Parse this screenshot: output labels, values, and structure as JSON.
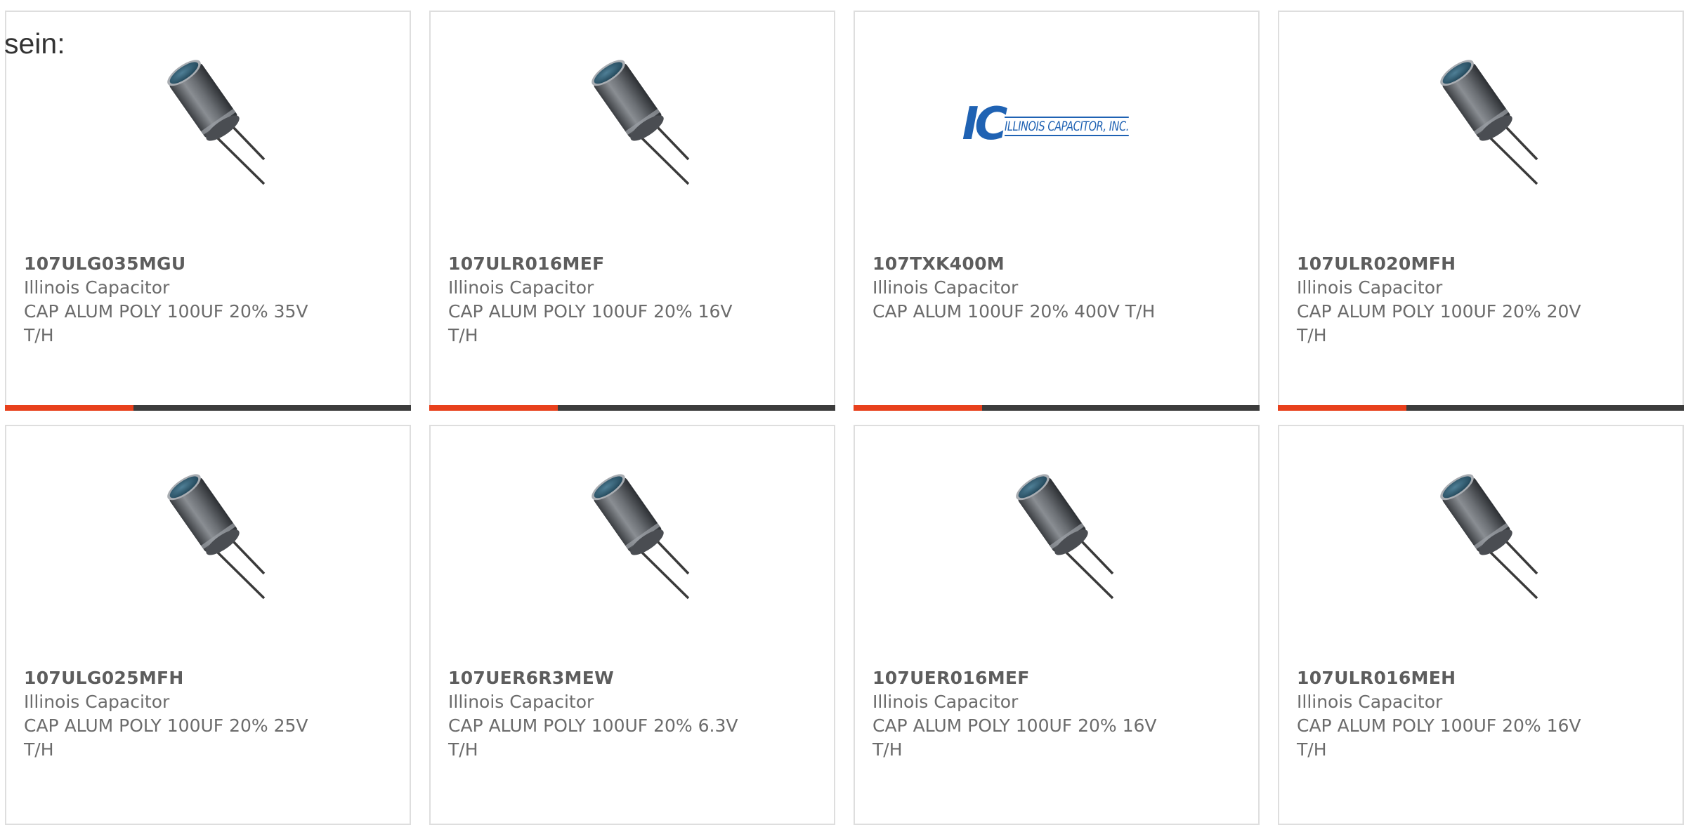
{
  "intro": "sein:",
  "accent_color": "#e8401c",
  "bar_color": "#3c3c3c",
  "logo": {
    "letters": "IC",
    "text": "ILLINOIS CAPACITOR, INC."
  },
  "products": [
    {
      "part_number": "107ULG035MGU",
      "manufacturer": "Illinois Capacitor",
      "description": "CAP ALUM POLY 100UF 20% 35V T/H",
      "image": "capacitor-image"
    },
    {
      "part_number": "107ULR016MEF",
      "manufacturer": "Illinois Capacitor",
      "description": "CAP ALUM POLY 100UF 20% 16V T/H",
      "image": "capacitor-image"
    },
    {
      "part_number": "107TXK400M",
      "manufacturer": "Illinois Capacitor",
      "description": "CAP ALUM 100UF 20% 400V T/H",
      "image": "manufacturer-logo"
    },
    {
      "part_number": "107ULR020MFH",
      "manufacturer": "Illinois Capacitor",
      "description": "CAP ALUM POLY 100UF 20% 20V T/H",
      "image": "capacitor-image"
    },
    {
      "part_number": "107ULG025MFH",
      "manufacturer": "Illinois Capacitor",
      "description": "CAP ALUM POLY 100UF 20% 25V T/H",
      "image": "capacitor-image"
    },
    {
      "part_number": "107UER6R3MEW",
      "manufacturer": "Illinois Capacitor",
      "description": "CAP ALUM POLY 100UF 20% 6.3V T/H",
      "image": "capacitor-image"
    },
    {
      "part_number": "107UER016MEF",
      "manufacturer": "Illinois Capacitor",
      "description": "CAP ALUM POLY 100UF 20% 16V T/H",
      "image": "capacitor-image"
    },
    {
      "part_number": "107ULR016MEH",
      "manufacturer": "Illinois Capacitor",
      "description": "CAP ALUM POLY 100UF 20% 16V T/H",
      "image": "capacitor-image"
    }
  ]
}
